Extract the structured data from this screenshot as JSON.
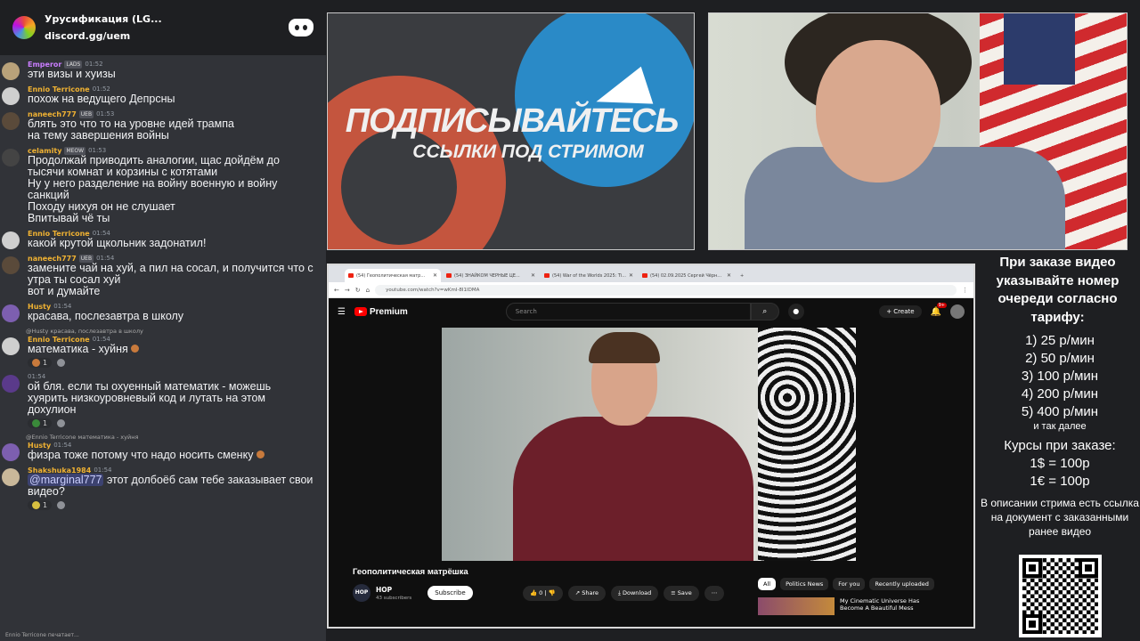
{
  "discord": {
    "server_name": "Урусификация (LG...",
    "invite": "discord.gg/uem",
    "messages": [
      {
        "name": "Emperor",
        "badge": "LADS",
        "time": "01:52",
        "text": [
          "эти визы и хуизы"
        ],
        "color": "#c97dff"
      },
      {
        "name": "Ennio Terricone",
        "badge": "",
        "time": "01:52",
        "text": [
          "похож на ведущего Депрсны"
        ],
        "color": "#f0b232"
      },
      {
        "name": "naneech777",
        "badge": "UEB",
        "time": "01:53",
        "text": [
          "блять это что то на уровне идей трампа",
          "на тему завершения войны"
        ],
        "color": "#f0b232"
      },
      {
        "name": "celamity",
        "badge": "MEOW",
        "time": "01:53",
        "text": [
          "Продолжай приводить аналогии, щас дойдём до",
          "тысячи комнат и корзины с котятами",
          "Ну у него разделение на войну военную и войну",
          "санкций",
          "Походу нихуя он не слушает",
          "Впитывай чё ты"
        ],
        "color": "#f0b232"
      },
      {
        "name": "Ennio Terricone",
        "badge": "",
        "time": "01:54",
        "text": [
          "какой крутой щкольник задонатил!"
        ],
        "color": "#f0b232"
      },
      {
        "name": "naneech777",
        "badge": "UEB",
        "time": "01:54",
        "text": [
          "замените чай на хуй, а пил на сосал, и получится что с",
          "утра ты сосал хуй",
          "вот и думайте"
        ],
        "color": "#f0b232"
      },
      {
        "name": "Husty",
        "badge": "",
        "time": "01:54",
        "text": [
          "красава, послезавтра в школу"
        ],
        "color": "#f0b232"
      }
    ],
    "reply1": "@Husty красава, послезавтра в школу",
    "m8": {
      "name": "Ennio Terricone",
      "time": "01:54",
      "text": "математика - хуйня",
      "reaction_count": "1"
    },
    "m9": {
      "time": "01:54",
      "text": [
        "ой бля. если ты охуенный математик - можешь",
        "хуярить низкоуровневый код и лутать на этом",
        "дохулион"
      ],
      "reaction_count": "1"
    },
    "reply2": "@Ennio Terricone математика - хуйня",
    "m10": {
      "name": "Husty",
      "time": "01:54",
      "text": "физра тоже потому что надо носить сменку"
    },
    "m11": {
      "name": "Shakshuka1984",
      "time": "01:54",
      "mention": "@marginal777",
      "text": " этот долбоёб сам тебе заказывает свои",
      "text2": "видео?",
      "reaction_count": "1"
    },
    "typing": "Ennio Terricone печатает..."
  },
  "promo": {
    "line1": "ПОДПИСЫВАЙТЕСЬ",
    "line2": "ССЫЛКИ ПОД СТРИМОМ"
  },
  "browser": {
    "tabs": [
      "(54) Геополитическая матр...",
      "(54) ЗНАЙКОМ ЧЕРНЫЕ ЦЕ...",
      "(54) War of the Worlds 2025: Ti...",
      "(54) 02.09.2025 Сергей Чёрн..."
    ],
    "url": "youtube.com/watch?v=wKmI-8I1IDMA"
  },
  "youtube": {
    "logo": "Premium",
    "search_placeholder": "Search",
    "create": "Create",
    "notif_count": "9+",
    "video_title": "Геополитическая матрёшка",
    "channel": "НОР",
    "channel_avatar": "НОР",
    "subs": "43 subscribers",
    "subscribe": "Subscribe",
    "likes": "0",
    "share": "Share",
    "download": "Download",
    "save": "Save",
    "chips": [
      "All",
      "Politics News",
      "For you",
      "Recently uploaded"
    ],
    "rec_title": "My Cinematic Universe Has Become A Beautiful Mess"
  },
  "side": {
    "title": "При заказе видео указывайте номер очереди согласно тарифу:",
    "tariffs": [
      "1) 25 р/мин",
      "2) 50 р/мин",
      "3) 100 р/мин",
      "4) 200 р/мин",
      "5) 400 р/мин"
    ],
    "etc": "и так далее",
    "rates_title": "Курсы при заказе:",
    "rates": [
      "1$ = 100р",
      "1€ = 100р"
    ],
    "desc": "В описании стрима есть ссылка на документ с заказанными ранее видео"
  }
}
